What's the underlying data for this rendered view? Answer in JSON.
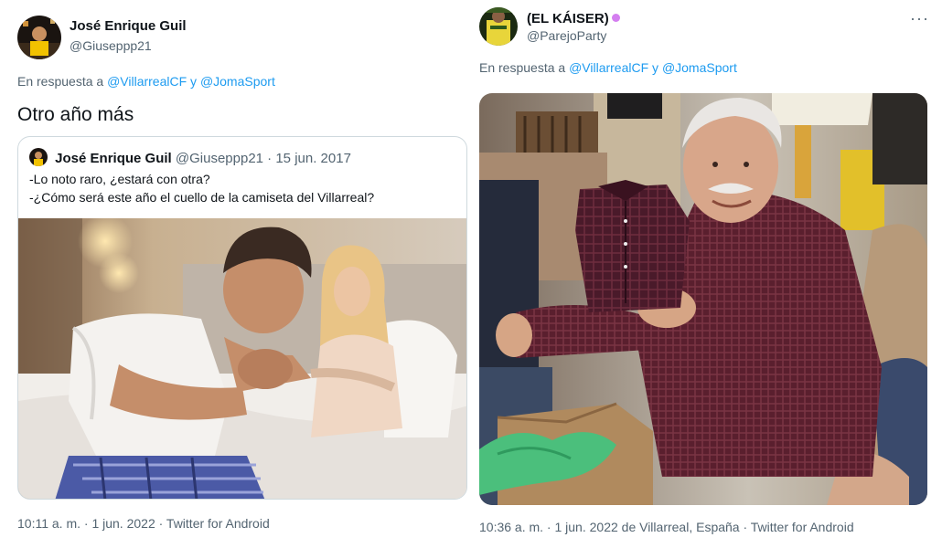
{
  "left_tweet": {
    "author_name": "José Enrique Guil",
    "author_handle": "@Giuseppp21",
    "reply_prefix": "En respuesta a",
    "reply_to_1": "@VillarrealCF",
    "reply_conj": "y",
    "reply_to_2": "@JomaSport",
    "text": "Otro año más",
    "quote": {
      "author_name": "José Enrique Guil",
      "author_handle": "@Giuseppp21",
      "separator": "·",
      "date": "15 jun. 2017",
      "line1": "-Lo noto raro, ¿estará con otra?",
      "line2": "-¿Cómo será este año el cuello de la camiseta del Villarreal?"
    },
    "footer": "10:11 a. m. · 1 jun. 2022 · Twitter for Android"
  },
  "right_tweet": {
    "author_name": "(EL KÁISER)",
    "author_handle": "@ParejoParty",
    "reply_prefix": "En respuesta a",
    "reply_to_1": "@VillarrealCF",
    "reply_conj": "y",
    "reply_to_2": "@JomaSport",
    "more_label": "···",
    "footer": "10:36 a. m. · 1 jun. 2022 de Villarreal, España · Twitter for Android"
  },
  "colors": {
    "link": "#1d9bf0",
    "secondary_text": "#536471",
    "border": "#cfd9de"
  }
}
